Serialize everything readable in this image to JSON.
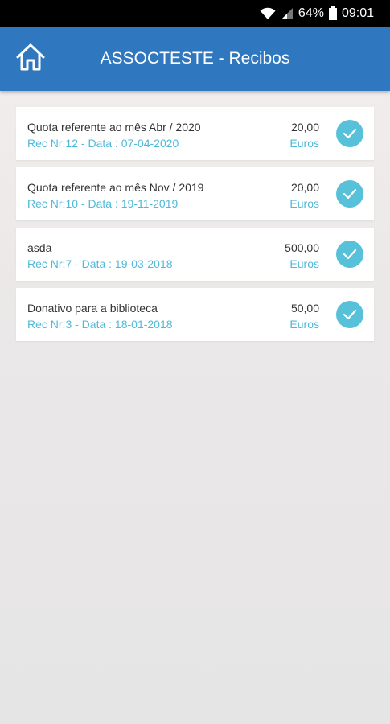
{
  "status_bar": {
    "battery_percent": "64%",
    "time": "09:01",
    "icons": [
      "wifi-icon",
      "signal-icon",
      "battery-icon"
    ]
  },
  "app_bar": {
    "title": "ASSOCTESTE - Recibos",
    "home_icon": "home-icon",
    "color": "#2f78bf"
  },
  "receipts": [
    {
      "description": "Quota referente ao mês Abr / 2020",
      "meta": "Rec Nr:12 - Data : 07-04-2020",
      "amount": "20,00",
      "currency": "Euros"
    },
    {
      "description": "Quota referente ao mês Nov / 2019",
      "meta": "Rec Nr:10 - Data : 19-11-2019",
      "amount": "20,00",
      "currency": "Euros"
    },
    {
      "description": "asda",
      "meta": "Rec Nr:7 - Data : 19-03-2018",
      "amount": "500,00",
      "currency": "Euros"
    },
    {
      "description": "Donativo para a biblioteca",
      "meta": "Rec Nr:3 - Data : 18-01-2018",
      "amount": "50,00",
      "currency": "Euros"
    }
  ],
  "colors": {
    "accent": "#4fb9d9",
    "check": "#56c1d8"
  }
}
